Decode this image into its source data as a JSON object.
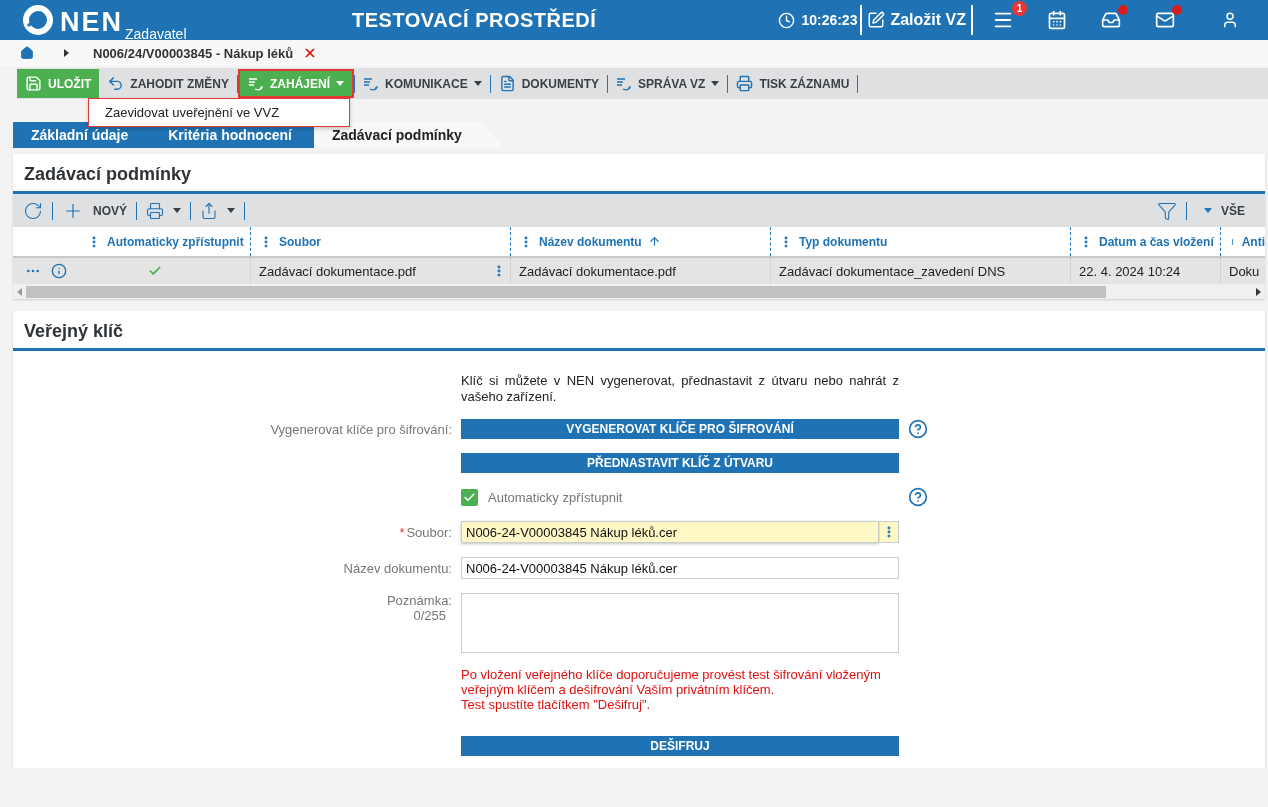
{
  "header": {
    "logo": "NEN",
    "logo_sub": "Zadavatel",
    "title": "TESTOVACÍ PROSTŘEDÍ",
    "time": "10:26:23",
    "create_label": "Založit VZ",
    "menu_badge": "1",
    "inbox_notification": true,
    "mail_notification": true
  },
  "breadcrumb": {
    "item": "N006/24/V00003845 - Nákup léků"
  },
  "toolbar": [
    {
      "label": "ULOŽIT",
      "dropdown": false,
      "open": false
    },
    {
      "label": "ZAHODIT ZMĚNY",
      "dropdown": false,
      "open": false
    },
    {
      "label": "ZAHÁJENÍ",
      "dropdown": true,
      "open": true
    },
    {
      "label": "KOMUNIKACE",
      "dropdown": true,
      "open": false
    },
    {
      "label": "DOKUMENTY",
      "dropdown": false,
      "open": false
    },
    {
      "label": "SPRÁVA VZ",
      "dropdown": true,
      "open": false
    },
    {
      "label": "TISK ZÁZNAMU",
      "dropdown": false,
      "open": false
    }
  ],
  "dropdown_menu": [
    "Zaevidovat uveřejnění ve VVZ"
  ],
  "tabs": [
    {
      "label": "Základní údaje",
      "selected": false
    },
    {
      "label": "Kritéria hodnocení",
      "selected": false
    },
    {
      "label": "Zadávací podmínky",
      "selected": true
    }
  ],
  "conditions": {
    "title": "Zadávací podmínky",
    "new_label": "NOVÝ",
    "filter_label": "VŠE",
    "columns": [
      {
        "label": "Automaticky zpřístupnit",
        "sorted": false
      },
      {
        "label": "Soubor",
        "sorted": false
      },
      {
        "label": "Název dokumentu",
        "sorted": true
      },
      {
        "label": "Typ dokumentu",
        "sorted": false
      },
      {
        "label": "Datum a čas vložení",
        "sorted": false
      },
      {
        "label": "Anti",
        "sorted": false
      }
    ],
    "rows": [
      {
        "auto_access": true,
        "file": "Zadávací dokumentace.pdf",
        "name": "Zadávací dokumentace.pdf",
        "type": "Zadávací dokumentace_zavedení DNS",
        "date": "22. 4. 2024 10:24",
        "column_6": "Doku"
      }
    ]
  },
  "public_key": {
    "title": "Veřejný klíč",
    "intro": "Klíč si můžete v NEN vygenerovat, přednastavit z útvaru nebo nahrát z vašeho zařízení.",
    "generate_label": "Vygenerovat klíče pro šifrování:",
    "generate_button": "VYGENEROVAT KLÍČE PRO ŠIFROVÁNÍ",
    "preset_button": "PŘEDNASTAVIT KLÍČ Z ÚTVARU",
    "auto_access": {
      "label": "Automaticky zpřístupnit",
      "checked": true
    },
    "file": {
      "label": "Soubor:",
      "required_mark": "*",
      "value": "N006-24-V00003845 Nákup léků.cer"
    },
    "doc_name": {
      "label": "Název dokumentu:",
      "value": "N006-24-V00003845 Nákup léků.cer"
    },
    "note": {
      "label": "Poznámka:",
      "counter": "0/255"
    },
    "warning": [
      "Po vložení veřejného klíče doporučujeme provést test šifrování vloženým veřejným klíčem a dešifrování Vaším privátním klíčem.",
      "Test spustíte tlačítkem \"Dešifruj\"."
    ],
    "decrypt_button": "DEŠIFRUJ"
  }
}
